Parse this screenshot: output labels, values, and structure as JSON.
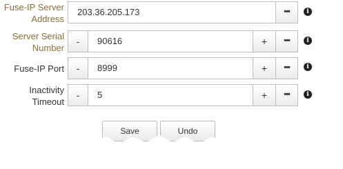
{
  "fields": [
    {
      "label": "Fuse-IP Server Address",
      "value": "203.36.205.173"
    },
    {
      "label": "Server Serial Number",
      "value": "90616"
    },
    {
      "label": "Fuse-IP Port",
      "value": "8999"
    },
    {
      "label": "Inactivity Timeout",
      "value": "5"
    }
  ],
  "buttons": {
    "minus": "-",
    "plus": "+",
    "more": "•••",
    "info": "i",
    "save": "Save",
    "undo": "Undo"
  },
  "colors": {
    "label_highlight": "#8a6d3b",
    "label_default": "#333333",
    "border": "#bdbdbd"
  }
}
